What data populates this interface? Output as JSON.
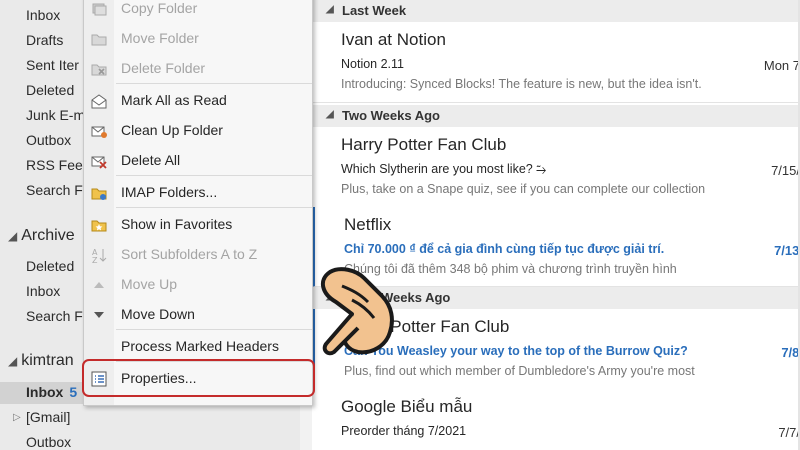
{
  "folders": {
    "items": [
      "Inbox",
      "Drafts",
      "Sent Iter",
      "Deleted",
      "Junk E-m",
      "Outbox",
      "RSS Feed",
      "Search F"
    ],
    "archive": {
      "title": "Archive",
      "items": [
        "Deleted",
        "Inbox",
        "Search F"
      ]
    },
    "account": {
      "title": "kimtran",
      "inbox_label": "Inbox",
      "inbox_count": "5",
      "gmail": "[Gmail]",
      "outbox": "Outbox"
    }
  },
  "context_menu": {
    "items": [
      {
        "label": "Copy Folder",
        "icon": "copy-folder-icon",
        "enabled": false
      },
      {
        "label": "Move Folder",
        "icon": "move-folder-icon",
        "enabled": false
      },
      {
        "label": "Delete Folder",
        "icon": "delete-folder-icon",
        "enabled": false
      },
      {
        "label": "Mark All as Read",
        "icon": "envelope-open-icon",
        "enabled": true
      },
      {
        "label": "Clean Up Folder",
        "icon": "clean-up-icon",
        "enabled": true
      },
      {
        "label": "Delete All",
        "icon": "delete-all-icon",
        "enabled": true
      },
      {
        "label": "IMAP Folders...",
        "icon": "imap-folder-icon",
        "enabled": true
      },
      {
        "label": "Show in Favorites",
        "icon": "star-folder-icon",
        "enabled": true
      },
      {
        "label": "Sort Subfolders A to Z",
        "icon": "sort-az-icon",
        "enabled": false
      },
      {
        "label": "Move Up",
        "icon": "arrow-up-icon",
        "enabled": false
      },
      {
        "label": "Move Down",
        "icon": "arrow-down-icon",
        "enabled": true
      },
      {
        "label": "Process Marked Headers",
        "icon": "",
        "enabled": true
      },
      {
        "label": "Properties...",
        "icon": "properties-icon",
        "enabled": true
      }
    ]
  },
  "message_list": {
    "groups": [
      {
        "title": "Last Week"
      },
      {
        "title": "Two Weeks Ago"
      },
      {
        "title": "Three Weeks Ago"
      }
    ],
    "messages": [
      {
        "sender": "Ivan at Notion",
        "subject": "Notion 2.11",
        "preview": "Introducing: Synced Blocks! The feature is new, but the idea isn't.",
        "date": "Mon 7",
        "unread": false
      },
      {
        "sender": "Harry Potter Fan Club",
        "subject": "Which Slytherin are you most like? ⥲",
        "preview": "Plus, take on a Snape quiz, see if you can complete our collection",
        "date": "7/15/",
        "unread": false
      },
      {
        "sender": "Netflix",
        "subject": "Chỉ 70.000 ₫ để cả gia đình cùng tiếp tục được giải trí.",
        "preview": "Chúng tôi đã thêm 348 bộ phim và chương trình truyền hình",
        "date": "7/13/",
        "unread": true
      },
      {
        "sender": "Harry Potter Fan Club",
        "subject": "Can You Weasley your way to the top of the Burrow Quiz?",
        "preview": "Plus, find out which member of Dumbledore's Army you're most",
        "date": "7/8/",
        "unread": true
      },
      {
        "sender": "Google Biểu mẫu",
        "subject": "Preorder tháng 7/2021",
        "preview": "",
        "date": "7/7/",
        "unread": false
      }
    ]
  },
  "colors": {
    "accent": "#2a6ebb",
    "highlight": "#c42b2b",
    "hand": "#f2c28f"
  }
}
